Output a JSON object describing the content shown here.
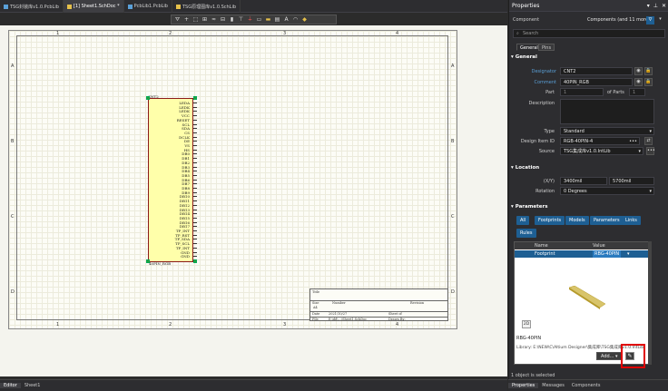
{
  "tabs": [
    {
      "label": "TSG封装库v1.0.PcbLib",
      "kind": "pcb"
    },
    {
      "label": "[1] Sheet1.SchDoc *",
      "kind": "sch",
      "active": true
    },
    {
      "label": "PcbLib1.PcbLib",
      "kind": "pcb"
    },
    {
      "label": "TSG原理图库v1.0.SchLib",
      "kind": "sch"
    }
  ],
  "toolbar": [
    "filter-icon",
    "add-icon",
    "select-icon",
    "align-icon",
    "wire-icon",
    "bus-icon",
    "net-label-icon",
    "power-icon",
    "gnd-icon",
    "port-icon",
    "component-icon",
    "sheet-icon",
    "text-icon",
    "arc-icon",
    "note-icon"
  ],
  "sheet": {
    "cols": [
      "1",
      "2",
      "3",
      "4"
    ],
    "rows": [
      "A",
      "B",
      "C",
      "D"
    ],
    "component": {
      "designator": "CNT2",
      "comment": "40PIN_RGB",
      "pins": [
        "LEDA",
        "LEDK",
        "LEDK",
        "VCC",
        "RESET",
        "SCL",
        "SDA",
        "CS",
        "DCLK",
        "DE",
        "VS",
        "HS",
        "DB0",
        "DB1",
        "DB2",
        "DB3",
        "DB4",
        "DB5",
        "DB6",
        "DB7",
        "DB8",
        "DB9",
        "DB10",
        "DB11",
        "DB12",
        "DB13",
        "DB14",
        "DB15",
        "DB16",
        "DB17",
        "TP_INT",
        "TP_RST",
        "TP_SDA",
        "TP_SCL",
        "TP_INT",
        "GND",
        "GND"
      ]
    },
    "titleblock": {
      "title": "Title",
      "size_label": "Size",
      "size": "A4",
      "number_label": "Number",
      "revision_label": "Revision",
      "date_label": "Date",
      "date": "2021/10/27",
      "file_label": "File",
      "file": "E:\\dd\\...\\Sheet1.SchDoc",
      "sheet_label": "Sheet  of",
      "drawnby_label": "Drawn By:"
    }
  },
  "bottom_tabs": [
    "Editor",
    "Sheet1"
  ],
  "panel": {
    "title": "Properties",
    "kind_label": "Component",
    "filter_label": "Components (and 11 more)",
    "search_placeholder": "Search",
    "subtabs": [
      "General",
      "Pins"
    ],
    "general": {
      "header": "General",
      "designator_label": "Designator",
      "designator": "CNT2",
      "comment_label": "Comment",
      "comment": "40PIN_RGB",
      "part_label": "Part",
      "part": "1",
      "of_parts_label": "of Parts",
      "of_parts": "1",
      "description_label": "Description",
      "description": "",
      "type_label": "Type",
      "type": "Standard",
      "design_item_label": "Design Item ID",
      "design_item": "RGB-40PIN-4",
      "source_label": "Source",
      "source": "TSG集成库v1.0.IntLib"
    },
    "location": {
      "header": "Location",
      "xy_label": "(X/Y)",
      "x": "3400mil",
      "y": "5700mil",
      "rotation_label": "Rotation",
      "rotation": "0 Degrees"
    },
    "parameters": {
      "header": "Parameters",
      "filters": [
        "All",
        "Footprints",
        "Models",
        "Parameters",
        "Links",
        "Rules"
      ],
      "col_name": "Name",
      "col_value": "Value",
      "row_name": "Footprint",
      "row_value": "RBG-40PIN",
      "view_2d": "2D",
      "footprint_name": "RBG-40PIN",
      "library": "Library: E:\\NEW\\C\\Altium Designer\\集成库\\TSG集成库v1.0.IntLib",
      "add_label": "Add...",
      "edit_icon": "pencil-icon"
    },
    "status": "1 object is selected",
    "bottom_tabs": [
      "Properties",
      "Messages",
      "Components"
    ]
  }
}
